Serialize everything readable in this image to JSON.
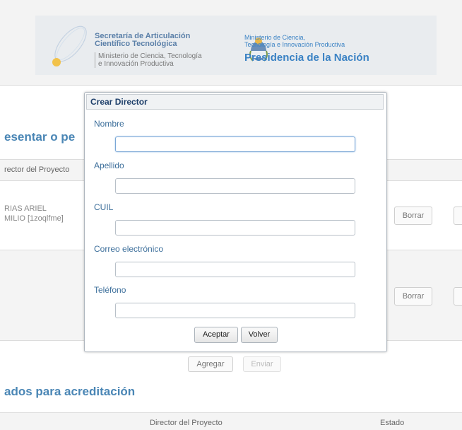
{
  "header": {
    "sact_title_line1": "Secretaría de Articulación",
    "sact_title_line2": "Científico Tecnológica",
    "sact_sub_line1": "Ministerio de Ciencia, Tecnología",
    "sact_sub_line2": "e Innovación Productiva",
    "min_line1": "Ministerio de Ciencia,",
    "min_line2": "Tecnología e Innovación Productiva",
    "presidencia": "Presidencia de la Nación"
  },
  "background": {
    "section1_title": "esentar o pe",
    "col_director": "rector del Proyecto",
    "row1_line1": "RIAS ARIEL",
    "row1_line2": "MILIO [1zoqlfme]",
    "delete_label": "Borrar",
    "add_label": "Agregar",
    "send_label": "Enviar",
    "section2_title": "ados para acreditación",
    "col2_director": "Director del Proyecto",
    "col2_estado": "Estado"
  },
  "modal": {
    "title": "Crear Director",
    "fields": [
      {
        "label": "Nombre",
        "value": ""
      },
      {
        "label": "Apellido",
        "value": ""
      },
      {
        "label": "CUIL",
        "value": ""
      },
      {
        "label": "Correo electrónico",
        "value": ""
      },
      {
        "label": "Teléfono",
        "value": ""
      }
    ],
    "accept_label": "Aceptar",
    "back_label": "Volver"
  }
}
